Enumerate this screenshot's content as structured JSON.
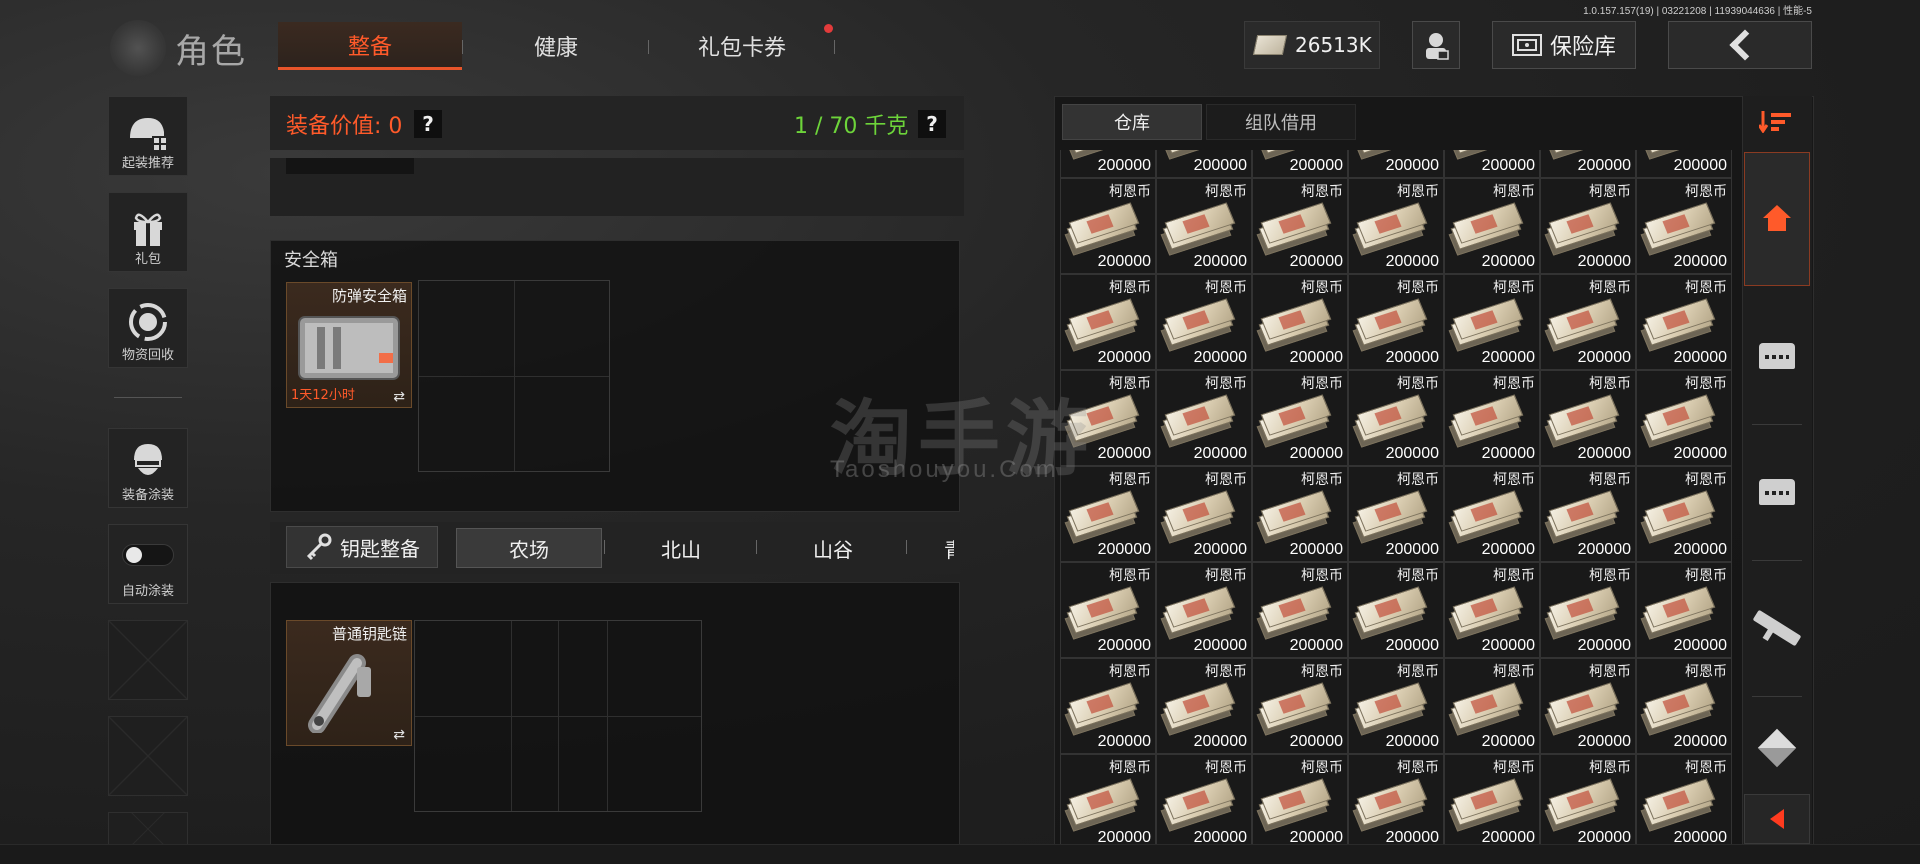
{
  "version_text": "1.0.157.157(19) | 03221208 | 11939044636 | 性能-5",
  "header": {
    "title": "角色",
    "tabs": [
      {
        "label": "整备",
        "active": true
      },
      {
        "label": "健康",
        "active": false
      },
      {
        "label": "礼包卡券",
        "active": false,
        "notification_dot": true
      }
    ],
    "currency": "26513K",
    "vault_label": "保险库",
    "colors": {
      "accent": "#ff5a2a",
      "weight_green": "#6dd43a",
      "notification": "#e23b3b"
    }
  },
  "sidebar": {
    "items": [
      {
        "label": "起装推荐",
        "icon": "helmet-icon"
      },
      {
        "label": "礼包",
        "icon": "gift-icon"
      },
      {
        "label": "物资回收",
        "icon": "recycle-icon"
      },
      {
        "label": "装备涂装",
        "icon": "soldier-icon"
      },
      {
        "label": "自动涂装",
        "icon": "toggle-icon",
        "toggle_on": false
      }
    ]
  },
  "equip": {
    "value_label": "装备价值: 0",
    "weight_label": "1 / 70 千克",
    "help": "?"
  },
  "safe_box": {
    "section_label": "安全箱",
    "item_name": "防弹安全箱",
    "timer": "1天12小时",
    "swap": "⇄"
  },
  "keys": {
    "button_label": "钥匙整备",
    "maps": [
      {
        "label": "农场",
        "active": true
      },
      {
        "label": "北山",
        "active": false
      },
      {
        "label": "山谷",
        "active": false
      },
      {
        "label": "青",
        "active": false
      }
    ],
    "item_name": "普通钥匙链",
    "swap": "⇄"
  },
  "warehouse": {
    "tabs": [
      {
        "label": "仓库",
        "active": true
      },
      {
        "label": "组队借用",
        "active": false
      }
    ],
    "item_name": "柯恩币",
    "item_value": "200000",
    "columns": 7,
    "rows": 8,
    "first_row_partial": true
  },
  "right_strip": [
    "sort-icon",
    "home-icon",
    "crate-icon",
    "crate-icon",
    "rifle-icon",
    "cube-icon",
    "collapse-icon"
  ],
  "watermark": {
    "main": "淘手游",
    "sub": "Taoshouyou.Com"
  }
}
